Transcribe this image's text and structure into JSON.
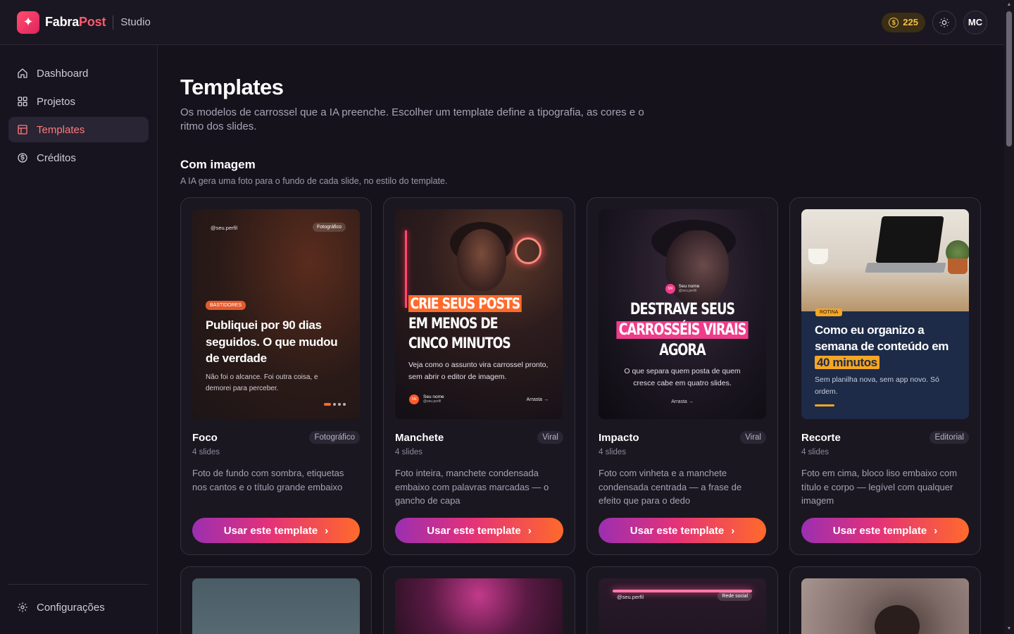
{
  "header": {
    "brand_fabra": "Fabra",
    "brand_post": "Post",
    "product": "Studio",
    "credits": "225",
    "avatar_initials": "MC",
    "icons": {
      "logo": "sparkle-icon",
      "coin": "coin-icon",
      "theme": "sun-icon"
    }
  },
  "sidebar": {
    "items": [
      {
        "label": "Dashboard",
        "icon": "home-icon",
        "active": false
      },
      {
        "label": "Projetos",
        "icon": "grid-icon",
        "active": false
      },
      {
        "label": "Templates",
        "icon": "layout-icon",
        "active": true
      },
      {
        "label": "Créditos",
        "icon": "coin-icon",
        "active": false
      }
    ],
    "footer": {
      "label": "Configurações",
      "icon": "gear-icon"
    }
  },
  "page": {
    "title": "Templates",
    "description": "Os modelos de carrossel que a IA preenche. Escolher um template define a tipografia, as cores e o ritmo dos slides."
  },
  "section": {
    "title": "Com imagem",
    "description": "A IA gera uma foto para o fundo de cada slide, no estilo do template."
  },
  "cards": [
    {
      "name": "Foco",
      "tag": "Fotográfico",
      "slides": "4 slides",
      "description": "Foto de fundo com sombra, etiquetas nos cantos e o título grande embaixo",
      "button": "Usar este template",
      "preview": {
        "handle": "@seu.perfil",
        "pill": "Fotográfico",
        "badge": "BASTIDORES",
        "title": "Publiquei por 90 dias seguidos. O que mudou de verdade",
        "subtitle": "Não foi o alcance. Foi outra coisa, e demorei para perceber."
      }
    },
    {
      "name": "Manchete",
      "tag": "Viral",
      "slides": "4 slides",
      "description": "Foto inteira, manchete condensada embaixo com palavras marcadas — o gancho de capa",
      "button": "Usar este template",
      "preview": {
        "headline_hl": "CRIE SEUS POSTS",
        "headline_rest": " EM MENOS DE CINCO MINUTOS",
        "subtitle": "Veja como o assunto vira carrossel pronto, sem abrir o editor de imagem.",
        "avatar": "SN",
        "name": "Seu nome",
        "handle": "@seu.perfil",
        "swipe": "Arrasta →"
      }
    },
    {
      "name": "Impacto",
      "tag": "Viral",
      "slides": "4 slides",
      "description": "Foto com vinheta e a manchete condensada centrada — a frase de efeito que para o dedo",
      "button": "Usar este template",
      "preview": {
        "avatar": "SN",
        "name": "Seu nome",
        "handle": "@seu.perfil",
        "line1": "DESTRAVE SEUS",
        "line2": "CARROSSÉIS VIRAIS",
        "line3": "AGORA",
        "subtitle": "O que separa quem posta de quem cresce cabe em quatro slides.",
        "swipe": "Arrasta →"
      }
    },
    {
      "name": "Recorte",
      "tag": "Editorial",
      "slides": "4 slides",
      "description": "Foto em cima, bloco liso embaixo com título e corpo — legível com qualquer imagem",
      "button": "Usar este template",
      "preview": {
        "badge": "ROTINA",
        "title_main": "Como eu organizo a semana de conteúdo em ",
        "title_hl": "40 minutos",
        "subtitle": "Sem planilha nova, sem app novo. Só ordem."
      }
    }
  ],
  "row2": {
    "card3_handle": "@seu.perfil",
    "card3_pill": "Rede social"
  },
  "colors": {
    "accent": "#ff5a6e",
    "background": "#15121c",
    "gold": "#f5c04a"
  }
}
